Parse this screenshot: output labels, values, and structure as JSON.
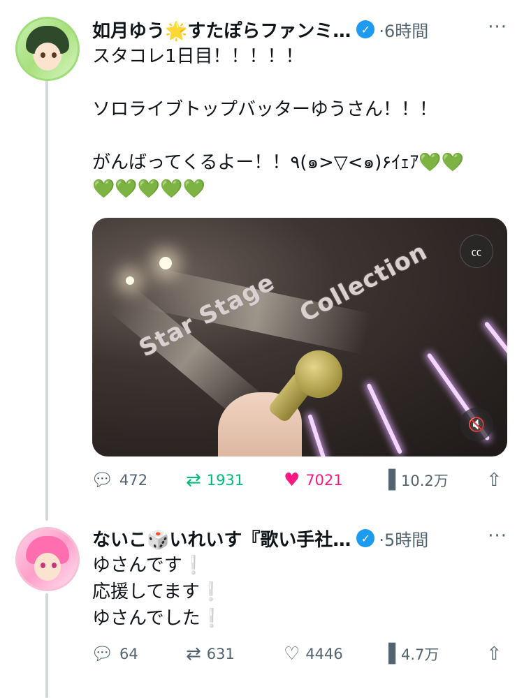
{
  "tweets": [
    {
      "author": "如月ゆう🌟すたぽらファンミ…",
      "time": "·6時間",
      "more": "···",
      "text_lines": [
        "スタコレ1日目！！！！！",
        "",
        "ソロライブトップバッターゆうさん！！！",
        "",
        "がんばってくるよー！！٩(๑>▽<๑)۶ｲｪｱ💚💚",
        "💚💚💚💚💚"
      ],
      "media": {
        "overlay_text_1": "Star Stage",
        "overlay_text_2": "Collection",
        "cc_icon": "captions-off-icon",
        "mute_icon": "muted-speaker-icon"
      },
      "stats": {
        "replies": "472",
        "retweets": "1931",
        "likes": "7021",
        "views": "10.2万"
      },
      "retweeted": true,
      "liked": true
    },
    {
      "author": "ないこ🎲いれいす『歌い手社…",
      "time": "·5時間",
      "more": "···",
      "text_lines": [
        "ゆさんです❕",
        "応援してます❕",
        "ゆさんでした❕"
      ],
      "stats": {
        "replies": "64",
        "retweets": "631",
        "likes": "4446",
        "views": "4.7万"
      },
      "retweeted": false,
      "liked": false
    }
  ],
  "icons": {
    "reply": "reply-bubble-icon",
    "retweet": "retweet-arrows-icon",
    "like": "heart-icon",
    "views": "bar-chart-icon",
    "share": "share-upload-icon",
    "verified": "verified-badge-icon"
  },
  "colors": {
    "verified": "#1d9bf0",
    "retweet": "#00ba7c",
    "like": "#f91880",
    "muted": "#536471"
  }
}
